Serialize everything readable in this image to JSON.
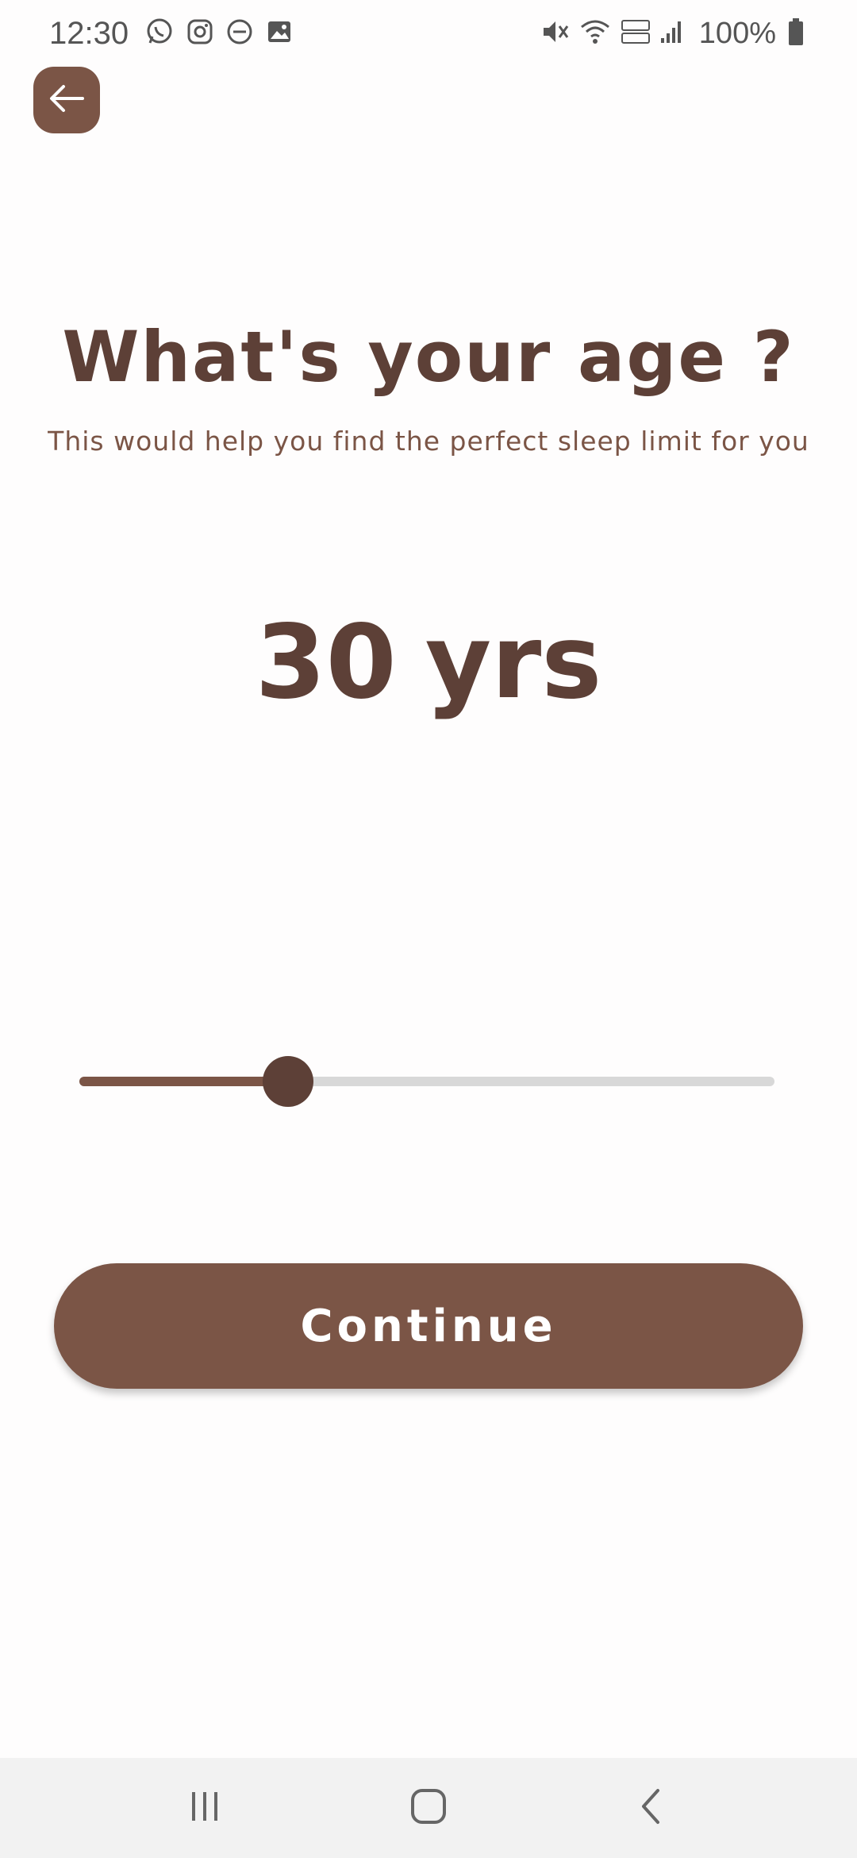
{
  "status_bar": {
    "time": "12:30",
    "left_icons": [
      "whatsapp-icon",
      "instagram-icon",
      "do-not-disturb-icon",
      "gallery-icon"
    ],
    "right_icons": [
      "mute-icon",
      "wifi-icon",
      "volte-icon",
      "signal-icon"
    ],
    "battery_text": "100%"
  },
  "header": {
    "back_icon": "arrow-left-icon"
  },
  "main": {
    "title": "What's your age ?",
    "subtitle": "This would help you find the perfect sleep limit for you",
    "age_value": "30",
    "age_unit": "yrs",
    "slider": {
      "value_fraction": 0.3
    },
    "continue_label": "Continue"
  },
  "nav_bar": {
    "icons": [
      "recent-apps-icon",
      "home-icon",
      "back-icon"
    ]
  },
  "colors": {
    "brand": "#7b5546",
    "brand_dark": "#5d4037",
    "track": "#d8d8d8",
    "background": "#fefdfd"
  }
}
